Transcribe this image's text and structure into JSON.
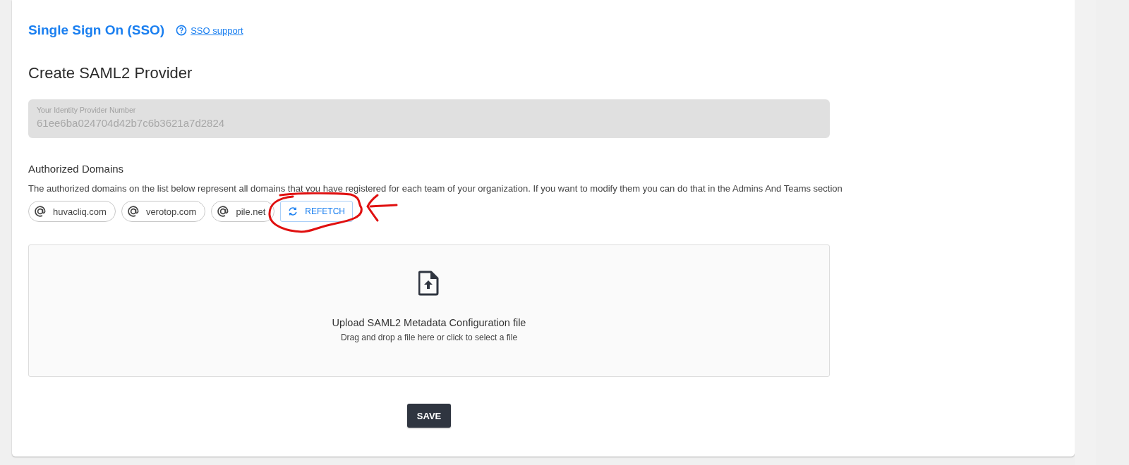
{
  "header": {
    "title": "Single Sign On (SSO)",
    "support_link": "SSO support"
  },
  "heading": "Create SAML2 Provider",
  "identity_field": {
    "label": "Your Identity Provider Number",
    "value": "61ee6ba024704d42b7c6b3621a7d2824",
    "disabled": true
  },
  "domains": {
    "title": "Authorized Domains",
    "description": "The authorized domains on the list below represent all domains that you have registered for each team of your organization. If you want to modify them you can do that in the Admins And Teams section",
    "items": [
      "huvacliq.com",
      "verotop.com",
      "pile.net"
    ],
    "refetch_button": "REFETCH"
  },
  "upload": {
    "title": "Upload SAML2 Metadata Configuration file",
    "hint": "Drag and drop a file here or click to select a file"
  },
  "save_button": "SAVE"
}
